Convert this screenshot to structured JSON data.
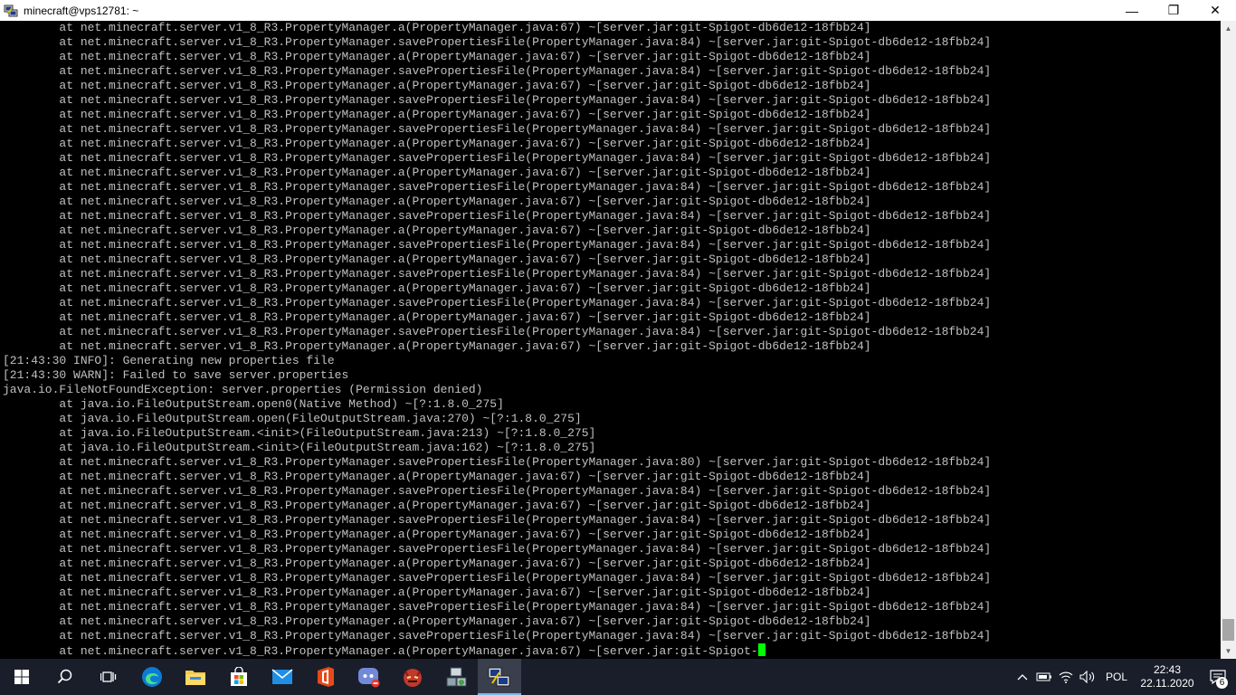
{
  "window": {
    "title": "minecraft@vps12781: ~",
    "minimize_label": "—",
    "maximize_label": "❐",
    "close_label": "✕"
  },
  "terminal": {
    "lines": [
      "        at net.minecraft.server.v1_8_R3.PropertyManager.a(PropertyManager.java:67) ~[server.jar:git-Spigot-db6de12-18fbb24]",
      "        at net.minecraft.server.v1_8_R3.PropertyManager.savePropertiesFile(PropertyManager.java:84) ~[server.jar:git-Spigot-db6de12-18fbb24]",
      "        at net.minecraft.server.v1_8_R3.PropertyManager.a(PropertyManager.java:67) ~[server.jar:git-Spigot-db6de12-18fbb24]",
      "        at net.minecraft.server.v1_8_R3.PropertyManager.savePropertiesFile(PropertyManager.java:84) ~[server.jar:git-Spigot-db6de12-18fbb24]",
      "        at net.minecraft.server.v1_8_R3.PropertyManager.a(PropertyManager.java:67) ~[server.jar:git-Spigot-db6de12-18fbb24]",
      "        at net.minecraft.server.v1_8_R3.PropertyManager.savePropertiesFile(PropertyManager.java:84) ~[server.jar:git-Spigot-db6de12-18fbb24]",
      "        at net.minecraft.server.v1_8_R3.PropertyManager.a(PropertyManager.java:67) ~[server.jar:git-Spigot-db6de12-18fbb24]",
      "        at net.minecraft.server.v1_8_R3.PropertyManager.savePropertiesFile(PropertyManager.java:84) ~[server.jar:git-Spigot-db6de12-18fbb24]",
      "        at net.minecraft.server.v1_8_R3.PropertyManager.a(PropertyManager.java:67) ~[server.jar:git-Spigot-db6de12-18fbb24]",
      "        at net.minecraft.server.v1_8_R3.PropertyManager.savePropertiesFile(PropertyManager.java:84) ~[server.jar:git-Spigot-db6de12-18fbb24]",
      "        at net.minecraft.server.v1_8_R3.PropertyManager.a(PropertyManager.java:67) ~[server.jar:git-Spigot-db6de12-18fbb24]",
      "        at net.minecraft.server.v1_8_R3.PropertyManager.savePropertiesFile(PropertyManager.java:84) ~[server.jar:git-Spigot-db6de12-18fbb24]",
      "        at net.minecraft.server.v1_8_R3.PropertyManager.a(PropertyManager.java:67) ~[server.jar:git-Spigot-db6de12-18fbb24]",
      "        at net.minecraft.server.v1_8_R3.PropertyManager.savePropertiesFile(PropertyManager.java:84) ~[server.jar:git-Spigot-db6de12-18fbb24]",
      "        at net.minecraft.server.v1_8_R3.PropertyManager.a(PropertyManager.java:67) ~[server.jar:git-Spigot-db6de12-18fbb24]",
      "        at net.minecraft.server.v1_8_R3.PropertyManager.savePropertiesFile(PropertyManager.java:84) ~[server.jar:git-Spigot-db6de12-18fbb24]",
      "        at net.minecraft.server.v1_8_R3.PropertyManager.a(PropertyManager.java:67) ~[server.jar:git-Spigot-db6de12-18fbb24]",
      "        at net.minecraft.server.v1_8_R3.PropertyManager.savePropertiesFile(PropertyManager.java:84) ~[server.jar:git-Spigot-db6de12-18fbb24]",
      "        at net.minecraft.server.v1_8_R3.PropertyManager.a(PropertyManager.java:67) ~[server.jar:git-Spigot-db6de12-18fbb24]",
      "        at net.minecraft.server.v1_8_R3.PropertyManager.savePropertiesFile(PropertyManager.java:84) ~[server.jar:git-Spigot-db6de12-18fbb24]",
      "        at net.minecraft.server.v1_8_R3.PropertyManager.a(PropertyManager.java:67) ~[server.jar:git-Spigot-db6de12-18fbb24]",
      "        at net.minecraft.server.v1_8_R3.PropertyManager.savePropertiesFile(PropertyManager.java:84) ~[server.jar:git-Spigot-db6de12-18fbb24]",
      "        at net.minecraft.server.v1_8_R3.PropertyManager.a(PropertyManager.java:67) ~[server.jar:git-Spigot-db6de12-18fbb24]",
      "[21:43:30 INFO]: Generating new properties file",
      "[21:43:30 WARN]: Failed to save server.properties",
      "java.io.FileNotFoundException: server.properties (Permission denied)",
      "        at java.io.FileOutputStream.open0(Native Method) ~[?:1.8.0_275]",
      "        at java.io.FileOutputStream.open(FileOutputStream.java:270) ~[?:1.8.0_275]",
      "        at java.io.FileOutputStream.<init>(FileOutputStream.java:213) ~[?:1.8.0_275]",
      "        at java.io.FileOutputStream.<init>(FileOutputStream.java:162) ~[?:1.8.0_275]",
      "        at net.minecraft.server.v1_8_R3.PropertyManager.savePropertiesFile(PropertyManager.java:80) ~[server.jar:git-Spigot-db6de12-18fbb24]",
      "        at net.minecraft.server.v1_8_R3.PropertyManager.a(PropertyManager.java:67) ~[server.jar:git-Spigot-db6de12-18fbb24]",
      "        at net.minecraft.server.v1_8_R3.PropertyManager.savePropertiesFile(PropertyManager.java:84) ~[server.jar:git-Spigot-db6de12-18fbb24]",
      "        at net.minecraft.server.v1_8_R3.PropertyManager.a(PropertyManager.java:67) ~[server.jar:git-Spigot-db6de12-18fbb24]",
      "        at net.minecraft.server.v1_8_R3.PropertyManager.savePropertiesFile(PropertyManager.java:84) ~[server.jar:git-Spigot-db6de12-18fbb24]",
      "        at net.minecraft.server.v1_8_R3.PropertyManager.a(PropertyManager.java:67) ~[server.jar:git-Spigot-db6de12-18fbb24]",
      "        at net.minecraft.server.v1_8_R3.PropertyManager.savePropertiesFile(PropertyManager.java:84) ~[server.jar:git-Spigot-db6de12-18fbb24]",
      "        at net.minecraft.server.v1_8_R3.PropertyManager.a(PropertyManager.java:67) ~[server.jar:git-Spigot-db6de12-18fbb24]",
      "        at net.minecraft.server.v1_8_R3.PropertyManager.savePropertiesFile(PropertyManager.java:84) ~[server.jar:git-Spigot-db6de12-18fbb24]",
      "        at net.minecraft.server.v1_8_R3.PropertyManager.a(PropertyManager.java:67) ~[server.jar:git-Spigot-db6de12-18fbb24]",
      "        at net.minecraft.server.v1_8_R3.PropertyManager.savePropertiesFile(PropertyManager.java:84) ~[server.jar:git-Spigot-db6de12-18fbb24]",
      "        at net.minecraft.server.v1_8_R3.PropertyManager.a(PropertyManager.java:67) ~[server.jar:git-Spigot-db6de12-18fbb24]",
      "        at net.minecraft.server.v1_8_R3.PropertyManager.savePropertiesFile(PropertyManager.java:84) ~[server.jar:git-Spigot-db6de12-18fbb24]"
    ],
    "last_line": "        at net.minecraft.server.v1_8_R3.PropertyManager.a(PropertyManager.java:67) ~[server.jar:git-Spigot-",
    "text_color": "#c0c0c0",
    "background_color": "#000000",
    "cursor_color": "#00ff00"
  },
  "taskbar": {
    "apps": [
      {
        "name": "start-button",
        "icon": "windows-icon",
        "active": false
      },
      {
        "name": "search-button",
        "icon": "search-icon",
        "active": false
      },
      {
        "name": "task-view-button",
        "icon": "task-view-icon",
        "active": false
      },
      {
        "name": "edge-button",
        "icon": "edge-icon",
        "active": false
      },
      {
        "name": "file-explorer-button",
        "icon": "folder-icon",
        "active": false
      },
      {
        "name": "store-button",
        "icon": "store-icon",
        "active": false
      },
      {
        "name": "mail-button",
        "icon": "mail-icon",
        "active": false
      },
      {
        "name": "office-button",
        "icon": "office-icon",
        "active": false
      },
      {
        "name": "discord-button",
        "icon": "discord-icon",
        "active": false
      },
      {
        "name": "game-app-button",
        "icon": "game-icon",
        "active": false
      },
      {
        "name": "network-app-button",
        "icon": "network-app-icon",
        "active": false
      },
      {
        "name": "putty-button",
        "icon": "putty-icon",
        "active": true
      }
    ],
    "tray": {
      "language": "POL",
      "time": "22:43",
      "date": "22.11.2020",
      "notification_count": "6"
    }
  }
}
